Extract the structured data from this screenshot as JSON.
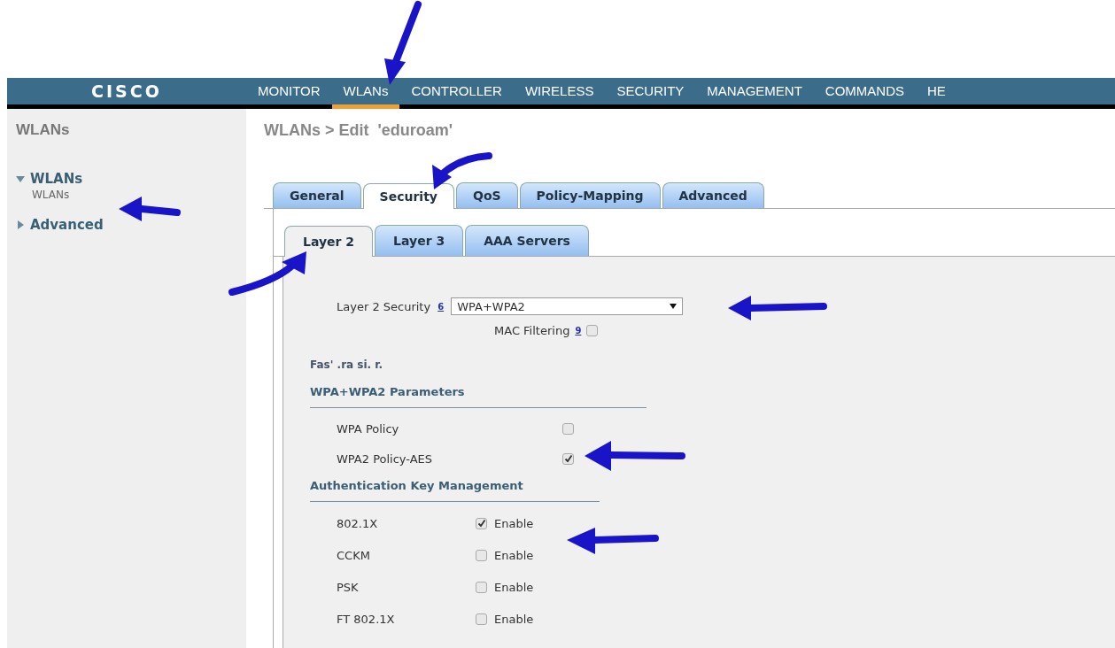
{
  "top_nav": {
    "logo": "CISCO",
    "items": [
      {
        "label": "MONITOR",
        "selected": false
      },
      {
        "label": "WLANs",
        "selected": true
      },
      {
        "label": "CONTROLLER",
        "selected": false
      },
      {
        "label": "WIRELESS",
        "selected": false
      },
      {
        "label": "SECURITY",
        "selected": false
      },
      {
        "label": "MANAGEMENT",
        "selected": false
      },
      {
        "label": "COMMANDS",
        "selected": false
      },
      {
        "label": "HE",
        "selected": false
      }
    ]
  },
  "sidebar": {
    "title": "WLANs",
    "items": [
      {
        "label": "WLANs",
        "expanded": true,
        "children": [
          {
            "label": "WLANs"
          }
        ]
      },
      {
        "label": "Advanced",
        "expanded": false
      }
    ]
  },
  "page_title": "WLANs > Edit  'eduroam'",
  "tabs": [
    {
      "label": "General",
      "selected": false
    },
    {
      "label": "Security",
      "selected": true
    },
    {
      "label": "QoS",
      "selected": false
    },
    {
      "label": "Policy-Mapping",
      "selected": false
    },
    {
      "label": "Advanced",
      "selected": false
    }
  ],
  "subtabs": [
    {
      "label": "Layer 2",
      "selected": true
    },
    {
      "label": "Layer 3",
      "selected": false
    },
    {
      "label": "AAA Servers",
      "selected": false
    }
  ],
  "layer2_security": {
    "label": "Layer 2 Security",
    "help": "6",
    "value": "WPA+WPA2"
  },
  "mac_filtering": {
    "label": "MAC Filtering",
    "help": "9",
    "checked": false
  },
  "fast_transition_heading": "Fas' .ra si. r.",
  "wpa_section": {
    "title": "WPA+WPA2 Parameters",
    "rows": [
      {
        "label": "WPA Policy",
        "checked": false
      },
      {
        "label": "WPA2 Policy-AES",
        "checked": true
      }
    ]
  },
  "akm_section": {
    "title": "Authentication Key Management",
    "rows": [
      {
        "label": "802.1X",
        "checked": true,
        "option": "Enable"
      },
      {
        "label": "CCKM",
        "checked": false,
        "option": "Enable"
      },
      {
        "label": "PSK",
        "checked": false,
        "option": "Enable"
      },
      {
        "label": "FT 802.1X",
        "checked": false,
        "option": "Enable"
      }
    ]
  }
}
